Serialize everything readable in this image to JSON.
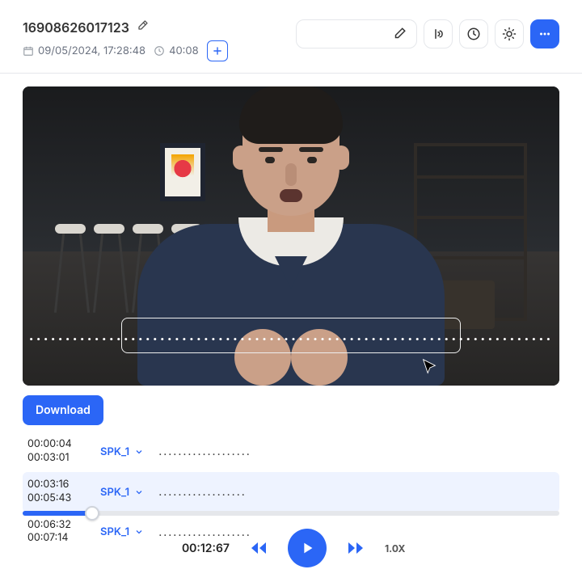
{
  "header": {
    "title": "16908626017123",
    "date": "09/05/2024, 17:28:48",
    "duration": "40:08"
  },
  "video": {
    "caption_placeholder": "........................................................................"
  },
  "actions": {
    "download_label": "Download"
  },
  "transcript": [
    {
      "start": "00:00:04",
      "end": "00:03:01",
      "speaker": "SPK_1",
      "text": "...................",
      "selected": false
    },
    {
      "start": "00:03:16",
      "end": "00:05:43",
      "speaker": "SPK_1",
      "text": "..................",
      "selected": true
    },
    {
      "start": "00:06:32",
      "end": "00:07:14",
      "speaker": "SPK_1",
      "text": "...................",
      "selected": false
    }
  ],
  "player": {
    "current_time": "00:12:67",
    "speed": "1.0X",
    "progress_pct": 13
  }
}
